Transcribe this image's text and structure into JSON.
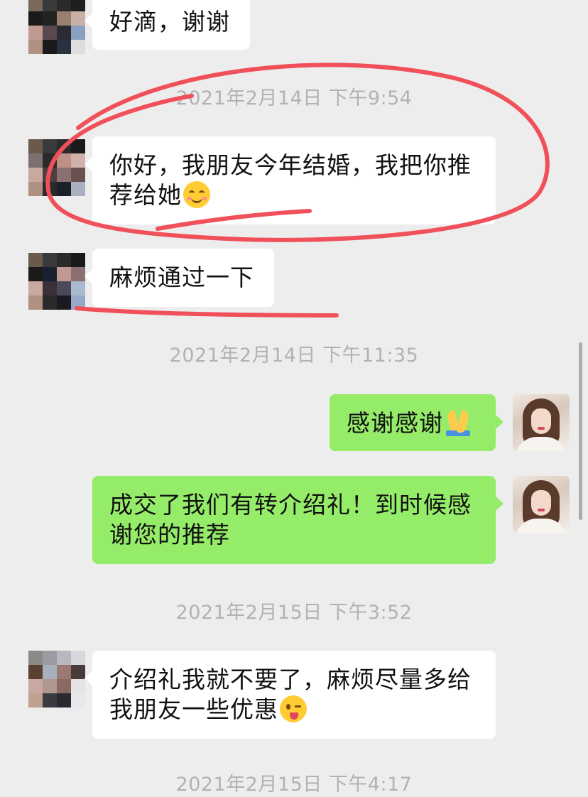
{
  "messages": [
    {
      "side": "in",
      "text": "好滴，谢谢",
      "emoji": null
    },
    {
      "timestamp": "2021年2月14日 下午9:54"
    },
    {
      "side": "in",
      "text": "你好，我朋友今年结婚，我把你推荐给她",
      "emoji": "smiling-face-icon"
    },
    {
      "side": "in",
      "text": "麻烦通过一下",
      "emoji": null
    },
    {
      "timestamp": "2021年2月14日 下午11:35"
    },
    {
      "side": "out",
      "text": "感谢感谢",
      "emoji": "folded-hands-icon"
    },
    {
      "side": "out",
      "text": "成交了我们有转介绍礼！到时候感谢您的推荐",
      "emoji": null
    },
    {
      "timestamp": "2021年2月15日 下午3:52"
    },
    {
      "side": "in",
      "text": "介绍礼我就不要了，麻烦尽量多给我朋友一些优惠",
      "emoji": "winking-tongue-face-icon"
    },
    {
      "timestamp": "2021年2月15日 下午4:17"
    }
  ],
  "chat": {
    "m0_text": "好滴，谢谢",
    "ts1": "2021年2月14日 下午9:54",
    "m1_text": "你好，我朋友今年结婚，我把你推荐给她",
    "m2_text": "麻烦通过一下",
    "ts2": "2021年2月14日 下午11:35",
    "m3_text": "感谢感谢",
    "m4_text": "成交了我们有转介绍礼！到时候感谢您的推荐",
    "ts3": "2021年2月15日 下午3:52",
    "m5_text": "介绍礼我就不要了，麻烦尽量多给我朋友一些优惠",
    "ts4": "2021年2月15日 下午4:17"
  },
  "colors": {
    "background": "#ededed",
    "incoming_bubble": "#ffffff",
    "outgoing_bubble": "#95ec69",
    "timestamp_text": "#b2b2b2",
    "annotation_red": "#f0505a"
  },
  "avatars": {
    "contact": "pixelated-contact-avatar",
    "self": "woman-portrait-avatar"
  }
}
